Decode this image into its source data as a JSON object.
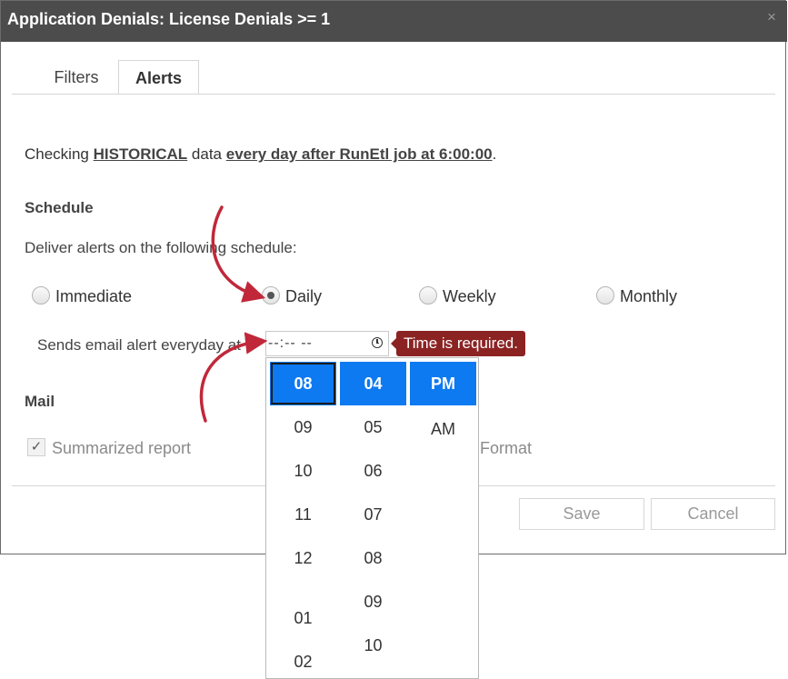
{
  "dialog": {
    "title": "Application Denials: License Denials >= 1",
    "close_glyph": "×"
  },
  "tabs": [
    {
      "label": "Filters",
      "active": false
    },
    {
      "label": "Alerts",
      "active": true
    }
  ],
  "checking": {
    "prefix": "Checking ",
    "mode": "HISTORICAL",
    "middle": " data ",
    "schedule_link": "every day after RunEtl job at 6:00:00",
    "suffix": "."
  },
  "schedule": {
    "heading": "Schedule",
    "deliver_text": "Deliver alerts on the following schedule:",
    "options": [
      {
        "label": "Immediate",
        "checked": false
      },
      {
        "label": "Daily",
        "checked": true
      },
      {
        "label": "Weekly",
        "checked": false
      },
      {
        "label": "Monthly",
        "checked": false
      }
    ],
    "sends_text": "Sends email alert everyday at",
    "time_value": "--:-- --",
    "error_tooltip": "Time is required."
  },
  "mail": {
    "heading": "Mail",
    "summarized_label": "Summarized report",
    "summarized_checked": true,
    "checkmark": "✓",
    "format_label": "Format"
  },
  "footer": {
    "save_label": "Save",
    "cancel_label": "Cancel"
  },
  "time_picker": {
    "hours": [
      "08",
      "09",
      "10",
      "11",
      "12",
      "01",
      "02"
    ],
    "minutes": [
      "04",
      "05",
      "06",
      "07",
      "08",
      "09",
      "10"
    ],
    "meridiem": [
      "PM",
      "AM"
    ],
    "selected_hour": "08",
    "selected_minute": "04",
    "selected_meridiem": "PM"
  },
  "colors": {
    "titlebar_bg": "#4c4c4c",
    "selected_bg": "#0e7af2",
    "error_bg": "#8b2323",
    "arrow": "#c0283a"
  },
  "annotations": [
    "curved-arrow-to-daily-radio",
    "curved-arrow-to-time-input"
  ]
}
